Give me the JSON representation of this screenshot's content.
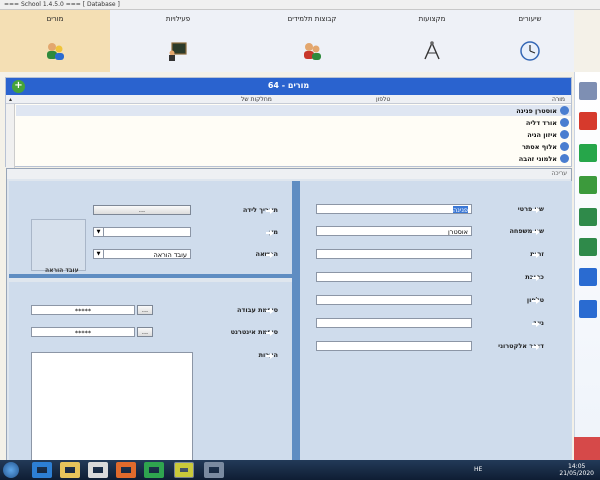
{
  "window": {
    "title": "=== School 1.4.5.0 ===  [ Database ]"
  },
  "tabs": [
    {
      "label": "שיעורים",
      "icon": "clock-icon"
    },
    {
      "label": "מקצועות",
      "icon": "compass-icon"
    },
    {
      "label": "קבוצות תלמידים",
      "icon": "student-group-icon"
    },
    {
      "label": "פעילויות",
      "icon": "blackboard-icon"
    },
    {
      "label": "מורים",
      "icon": "teachers-icon"
    }
  ],
  "list": {
    "title": "מורים - 64",
    "add_label": "+",
    "columns": {
      "name": "מורה",
      "phone": "טלפון",
      "department": "מחלקות של"
    },
    "rows": [
      {
        "name": "אוסטרן פנינה"
      },
      {
        "name": "אורד דליה"
      },
      {
        "name": "איזון הניה"
      },
      {
        "name": "אלוף אסתר"
      },
      {
        "name": "אלמוני זהבה"
      }
    ]
  },
  "editor": {
    "title": "עריכה",
    "fields": {
      "first_name": {
        "label": "שם פרטי",
        "value": "פנינה"
      },
      "last_name": {
        "label": "שם משפחה",
        "value": "אוסטרן"
      },
      "id": {
        "label": "זהות",
        "value": ""
      },
      "address": {
        "label": "כתובת",
        "value": ""
      },
      "phone": {
        "label": "טלפון",
        "value": ""
      },
      "mobile": {
        "label": "נייד",
        "value": ""
      },
      "email": {
        "label": "דואר אלקטרוני",
        "value": ""
      },
      "birth_date": {
        "label": "תאריך לידה",
        "button": "..."
      },
      "gender": {
        "label": "מין",
        "value": ""
      },
      "license": {
        "label": "הרשאה",
        "value": "עובד הוראה"
      },
      "photo_label": "עובד הוראה",
      "work_password": {
        "label": "סיסמת עבודה",
        "value": "*****",
        "button": "..."
      },
      "internet_password": {
        "label": "סיסמת אינטרנט",
        "value": "*****",
        "button": "..."
      },
      "notes": {
        "label": "הערות"
      }
    }
  },
  "sidebar": {
    "items": [
      {
        "icon": "windows-stack-icon",
        "color": "#7e8fb3"
      },
      {
        "icon": "calendar-31-icon",
        "color": "#d63a2c"
      },
      {
        "icon": "score-100-icon",
        "color": "#26a64a"
      },
      {
        "icon": "calendar-green-icon",
        "color": "#3c9a3c"
      },
      {
        "icon": "grid-calendar-icon",
        "color": "#2f8a4a"
      },
      {
        "icon": "grid-edit-icon",
        "color": "#2f8a4a"
      },
      {
        "icon": "gear-icon",
        "color": "#2a6bd1"
      },
      {
        "icon": "info-icon",
        "color": "#2a6bd1"
      }
    ]
  },
  "taskbar": {
    "items": [
      {
        "icon": "ie-icon"
      },
      {
        "icon": "folder-icon"
      },
      {
        "icon": "media-icon"
      },
      {
        "icon": "firefox-icon"
      },
      {
        "icon": "chrome-icon"
      },
      {
        "icon": "school-app-icon"
      },
      {
        "icon": "tool-icon"
      }
    ],
    "lang": "HE",
    "time": "14:05",
    "date": "21/05/2020"
  }
}
